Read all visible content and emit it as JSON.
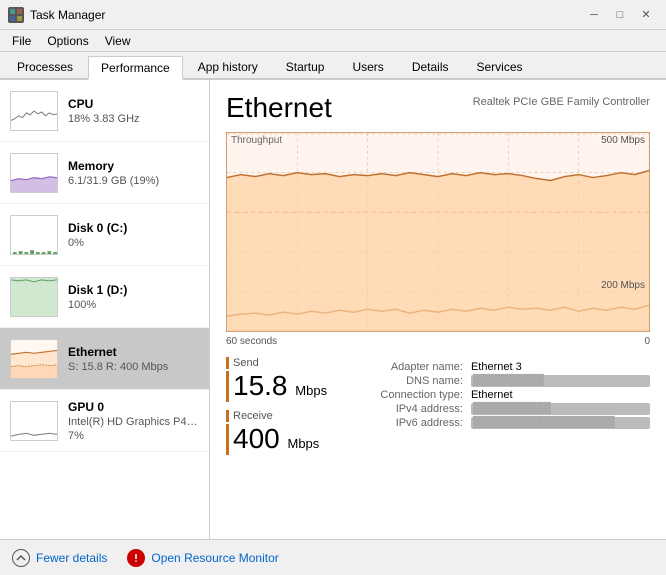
{
  "titlebar": {
    "icon": "TM",
    "title": "Task Manager",
    "min_btn": "─",
    "max_btn": "□",
    "close_btn": "✕"
  },
  "menubar": {
    "items": [
      "File",
      "Options",
      "View"
    ]
  },
  "tabs": [
    {
      "label": "Processes",
      "active": false
    },
    {
      "label": "Performance",
      "active": true
    },
    {
      "label": "App history",
      "active": false
    },
    {
      "label": "Startup",
      "active": false
    },
    {
      "label": "Users",
      "active": false
    },
    {
      "label": "Details",
      "active": false
    },
    {
      "label": "Services",
      "active": false
    }
  ],
  "left_panel": {
    "items": [
      {
        "id": "cpu",
        "title": "CPU",
        "subtitle": "18% 3.83 GHz",
        "active": false
      },
      {
        "id": "memory",
        "title": "Memory",
        "subtitle": "6.1/31.9 GB (19%)",
        "active": false
      },
      {
        "id": "disk0",
        "title": "Disk 0 (C:)",
        "subtitle": "0%",
        "active": false
      },
      {
        "id": "disk1",
        "title": "Disk 1 (D:)",
        "subtitle": "100%",
        "active": false
      },
      {
        "id": "ethernet",
        "title": "Ethernet",
        "subtitle": "S: 15.8  R: 400 Mbps",
        "active": true
      },
      {
        "id": "gpu0",
        "title": "GPU 0",
        "subtitle": "Intel(R) HD Graphics P4…",
        "subtitle2": "7%",
        "active": false
      }
    ]
  },
  "right_panel": {
    "title": "Ethernet",
    "subtitle": "Realtek PCIe GBE Family Controller",
    "chart": {
      "label_top_left": "Throughput",
      "label_top_right": "500 Mbps",
      "label_mid_right": "200 Mbps",
      "label_bottom_left": "60 seconds",
      "label_bottom_right": "0"
    },
    "stats": [
      {
        "label": "Send",
        "value": "15.8",
        "unit": "Mbps"
      },
      {
        "label": "Receive",
        "value": "400",
        "unit": "Mbps"
      }
    ],
    "info": {
      "adapter_name_key": "Adapter name:",
      "adapter_name_val": "Ethernet 3",
      "dns_name_key": "DNS name:",
      "dns_name_val": "██████████",
      "connection_type_key": "Connection type:",
      "connection_type_val": "Ethernet",
      "ipv4_key": "IPv4 address:",
      "ipv4_val": "███████████",
      "ipv6_key": "IPv6 address:",
      "ipv6_val": "████████████████████"
    }
  },
  "bottom_bar": {
    "fewer_details_label": "Fewer details",
    "open_resource_monitor_label": "Open Resource Monitor"
  }
}
